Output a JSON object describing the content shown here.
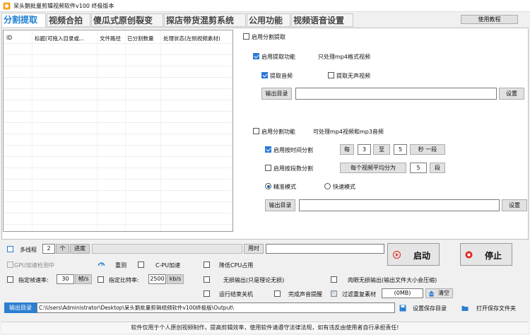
{
  "window": {
    "title": "呆头鹅批量剪辑视频软件v100 终极版本"
  },
  "tabs": [
    {
      "label": "分割提取",
      "active": true
    },
    {
      "label": "视频合拍",
      "active": false
    },
    {
      "label": "傻瓜式原创裂变",
      "active": false
    },
    {
      "label": "探店带货混剪系统",
      "active": false
    },
    {
      "label": "公用功能",
      "active": false
    },
    {
      "label": "视频语音设置",
      "active": false
    }
  ],
  "help_button": "使用教程",
  "table": {
    "columns": [
      "ID",
      "标题(可拖入目录或...",
      "文件路径",
      "已分割数量",
      "处理状态(左侧视频素材)"
    ]
  },
  "split_extract": {
    "enable_label": "启用分割提取",
    "enable_checked": false,
    "extract": {
      "enable_label": "启用提取功能",
      "enable_checked": true,
      "note": "只处理mp4格式视频",
      "audio_label": "提取音频",
      "audio_checked": true,
      "silent_label": "提取无声视频",
      "silent_checked": false,
      "output_button": "输出目录",
      "output_value": "",
      "settings_button": "设置"
    },
    "split": {
      "enable_label": "启用分割功能",
      "enable_checked": false,
      "note": "可处理mp4视频和mp3音频",
      "by_time_label": "启用按时间分割",
      "by_time_checked": true,
      "every": "每",
      "from_value": "3",
      "to": "至",
      "to_value": "5",
      "unit": "秒 一段",
      "by_count_label": "启用按段数分割",
      "by_count_checked": false,
      "avg_label": "每个视频平均分为",
      "count_value": "5",
      "count_unit": "段",
      "precise_label": "精准模式",
      "precise_checked": true,
      "fast_label": "快速模式",
      "fast_checked": false,
      "output_button": "输出目录",
      "output_value": "",
      "settings_button": "设置"
    }
  },
  "bottom": {
    "multithread_label": "多线程",
    "multithread_checked": false,
    "thread_count": "2",
    "thread_unit": "个",
    "progress_label": "进度",
    "progress_percent": 0,
    "time_label": "用时",
    "time_value": "",
    "start_button": "启动",
    "stop_button": "停止",
    "gpu_label": "GPU加速检测中",
    "gpu_checked": false,
    "redetect_label": "重测",
    "cpu_accel_label": "C-PU加速",
    "cpu_accel_checked": false,
    "lower_cpu_label": "降低CPU占用",
    "lower_cpu_checked": false,
    "framerate_label": "指定帧速率:",
    "framerate_checked": false,
    "framerate_value": "30",
    "framerate_unit": "帧/s",
    "bitrate_label": "指定比特率:",
    "bitrate_checked": false,
    "bitrate_value": "2500",
    "bitrate_unit": "kb/s",
    "lossless_label": "无损输出(只是理论无损)",
    "lossless_checked": false,
    "visual_lossless_label": "肉眼无损输出(输出文件大小会压缩)",
    "visual_lossless_checked": false,
    "shutdown_label": "运行结束关机",
    "shutdown_checked": false,
    "sound_label": "完成声音提醒",
    "sound_checked": false,
    "filter_label": "过滤重复素材",
    "filter_checked": true,
    "filter_size": "(0MB)",
    "clear_label": "清空",
    "output_label": "输出目录",
    "output_path": "C:\\Users\\Administrator\\Desktop\\呆头鹅批量剪辑视频软件v100终极版\\Output\\",
    "set_save_label": "设置保存目录",
    "open_folder_label": "打开保存文件夹"
  },
  "footer": "软件仅用于个人原创视频制作，提高剪辑效率，使用软件请遵守法律法规，如有违反由使用者自行承担责任!",
  "colors": {
    "accent": "#1d7fd3",
    "checked": "#2b79d8",
    "start_icon": "#e33b2e",
    "stop_icon": "#e0201e"
  }
}
